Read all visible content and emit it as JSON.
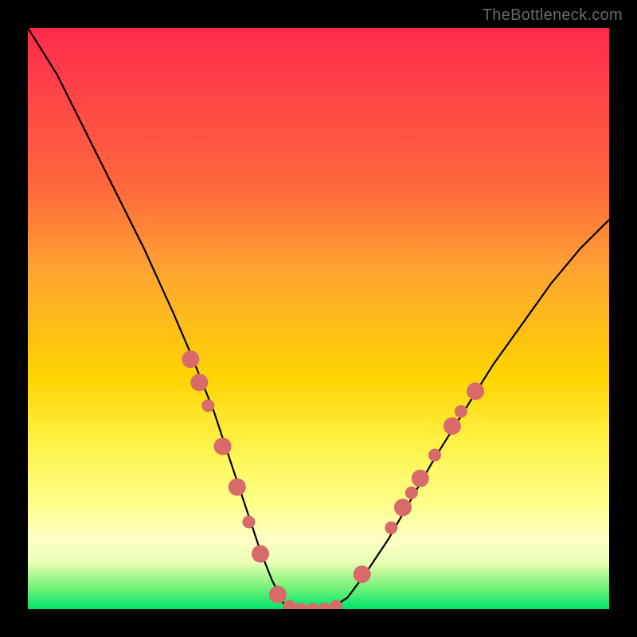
{
  "watermark": "TheBottleneck.com",
  "chart_data": {
    "type": "line",
    "title": "",
    "xlabel": "",
    "ylabel": "",
    "xlim": [
      0,
      100
    ],
    "ylim": [
      0,
      100
    ],
    "series": [
      {
        "name": "bottleneck-curve",
        "x": [
          0,
          5,
          10,
          15,
          20,
          25,
          28,
          30,
          32,
          34,
          36,
          38,
          40,
          42,
          44,
          46,
          48,
          50,
          52,
          55,
          58,
          62,
          66,
          70,
          75,
          80,
          85,
          90,
          95,
          100
        ],
        "y": [
          100,
          92,
          82,
          72,
          62,
          51,
          44,
          39,
          34,
          28,
          22,
          16,
          10,
          5,
          1,
          0,
          0,
          0,
          0,
          2,
          6,
          12,
          19,
          26,
          34,
          42,
          49,
          56,
          62,
          67
        ]
      }
    ],
    "markers": {
      "name": "highlight-points",
      "color": "#d86a6a",
      "radius_major": 11,
      "radius_minor": 8,
      "points": [
        {
          "x": 28.0,
          "y": 43.0,
          "r": "major"
        },
        {
          "x": 29.5,
          "y": 39.0,
          "r": "major"
        },
        {
          "x": 31.0,
          "y": 35.0,
          "r": "minor"
        },
        {
          "x": 33.5,
          "y": 28.0,
          "r": "major"
        },
        {
          "x": 36.0,
          "y": 21.0,
          "r": "major"
        },
        {
          "x": 38.0,
          "y": 15.0,
          "r": "minor"
        },
        {
          "x": 40.0,
          "y": 9.5,
          "r": "major"
        },
        {
          "x": 43.0,
          "y": 2.5,
          "r": "major"
        },
        {
          "x": 45.0,
          "y": 0.5,
          "r": "minor"
        },
        {
          "x": 47.0,
          "y": 0.0,
          "r": "minor"
        },
        {
          "x": 49.0,
          "y": 0.0,
          "r": "minor"
        },
        {
          "x": 51.0,
          "y": 0.0,
          "r": "minor"
        },
        {
          "x": 53.0,
          "y": 0.5,
          "r": "minor"
        },
        {
          "x": 57.5,
          "y": 6.0,
          "r": "major"
        },
        {
          "x": 62.5,
          "y": 14.0,
          "r": "minor"
        },
        {
          "x": 64.5,
          "y": 17.5,
          "r": "major"
        },
        {
          "x": 66.0,
          "y": 20.0,
          "r": "minor"
        },
        {
          "x": 67.5,
          "y": 22.5,
          "r": "major"
        },
        {
          "x": 70.0,
          "y": 26.5,
          "r": "minor"
        },
        {
          "x": 73.0,
          "y": 31.5,
          "r": "major"
        },
        {
          "x": 74.5,
          "y": 34.0,
          "r": "minor"
        },
        {
          "x": 77.0,
          "y": 37.5,
          "r": "major"
        }
      ]
    }
  }
}
